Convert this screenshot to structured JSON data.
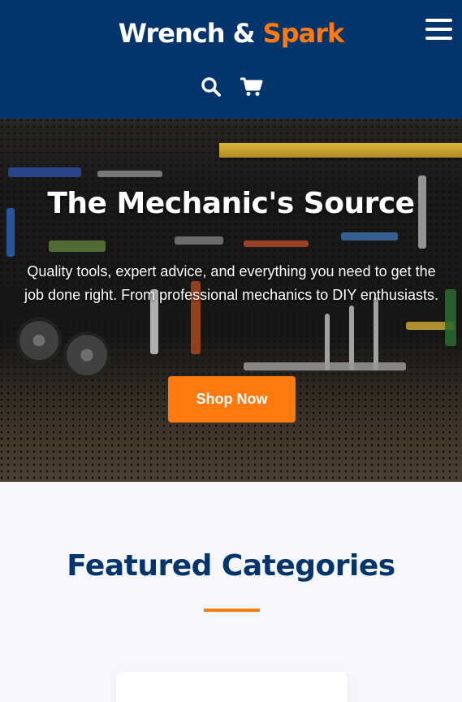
{
  "header": {
    "logo_part1": "Wrench & ",
    "logo_part2": "Spark",
    "icons": [
      "search-icon",
      "cart-icon",
      "menu-icon"
    ],
    "colors": {
      "background": "#03346b",
      "accent": "#ff7a0e"
    }
  },
  "hero": {
    "title": "The Mechanic's Source",
    "description": "Quality tools, expert advice, and everything you need to get the job done right. From professional mechanics to DIY enthusiasts.",
    "cta_label": "Shop Now"
  },
  "featured": {
    "title": "Featured Categories"
  }
}
